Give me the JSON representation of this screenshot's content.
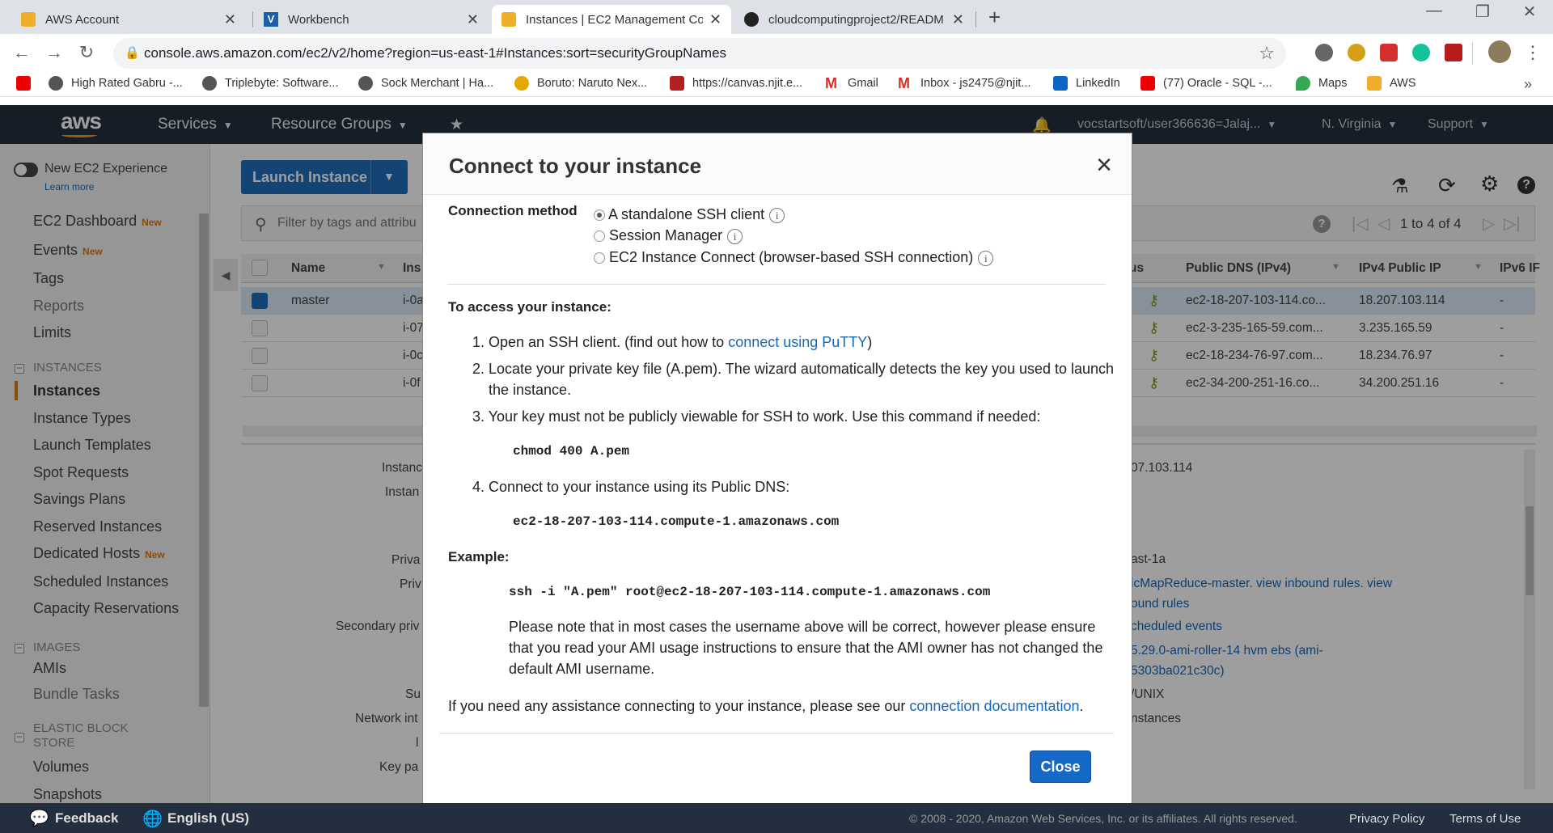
{
  "browser": {
    "tabs": [
      {
        "title": "AWS Account"
      },
      {
        "title": "Workbench"
      },
      {
        "title": "Instances | EC2 Management Co"
      },
      {
        "title": "cloudcomputingproject2/READM"
      }
    ],
    "url": "console.aws.amazon.com/ec2/v2/home?region=us-east-1#Instances:sort=securityGroupNames",
    "bookmarks": [
      "High Rated Gabru -...",
      "Triplebyte: Software...",
      "Sock Merchant | Ha...",
      "Boruto: Naruto Nex...",
      "https://canvas.njit.e...",
      "Gmail",
      "Inbox - js2475@njit...",
      "LinkedIn",
      "(77) Oracle - SQL -...",
      "Maps",
      "AWS"
    ]
  },
  "aws_header": {
    "logo": "aws",
    "services": "Services",
    "resource_groups": "Resource Groups",
    "account": "vocstartsoft/user366636=Jalaj...",
    "region": "N. Virginia",
    "support": "Support"
  },
  "sidebar": {
    "toggle_label": "New EC2 Experience",
    "learn_more": "Learn more",
    "new_badge": "New",
    "items_top": [
      {
        "label": "EC2 Dashboard",
        "new": true
      },
      {
        "label": "Events",
        "new": true
      },
      {
        "label": "Tags"
      },
      {
        "label": "Reports"
      },
      {
        "label": "Limits"
      }
    ],
    "section_instances": "INSTANCES",
    "instances_items": [
      "Instances",
      "Instance Types",
      "Launch Templates",
      "Spot Requests",
      "Savings Plans",
      "Reserved Instances",
      "Dedicated Hosts",
      "Scheduled Instances",
      "Capacity Reservations"
    ],
    "section_images": "IMAGES",
    "images_items": [
      "AMIs",
      "Bundle Tasks"
    ],
    "section_ebs": "ELASTIC BLOCK STORE",
    "ebs_items": [
      "Volumes",
      "Snapshots"
    ]
  },
  "main": {
    "launch_button": "Launch Instance",
    "filter_placeholder": "Filter by tags and attribu",
    "pagination": "1 to 4 of 4",
    "columns": {
      "name": "Name",
      "ins": "Ins",
      "us": "us",
      "dns": "Public DNS (IPv4)",
      "ip": "IPv4 Public IP",
      "ipv6": "IPv6 IF"
    },
    "rows": [
      {
        "name": "master",
        "id": "i-0a",
        "dns": "ec2-18-207-103-114.co...",
        "ip": "18.207.103.114",
        "ipv6": "-"
      },
      {
        "name": "",
        "id": "i-07",
        "dns": "ec2-3-235-165-59.com...",
        "ip": "3.235.165.59",
        "ipv6": "-"
      },
      {
        "name": "",
        "id": "i-0c",
        "dns": "ec2-18-234-76-97.com...",
        "ip": "18.234.76.97",
        "ipv6": "-"
      },
      {
        "name": "",
        "id": "i-0f",
        "dns": "ec2-34-200-251-16.co...",
        "ip": "34.200.251.16",
        "ipv6": "-"
      }
    ],
    "details_left": [
      "Instanc",
      "Instan",
      "Priva",
      "Priv",
      "Secondary priv",
      "Su",
      "Network int",
      "l",
      "Key pa"
    ],
    "details_right": [
      "07.103.114",
      "ast-1a",
      "icMapReduce-master. view inbound rules. view",
      "ound rules",
      "cheduled events",
      "5.29.0-ami-roller-14 hvm ebs (ami-",
      "5303ba021c30c)",
      "/UNIX",
      "nstances"
    ]
  },
  "modal": {
    "title": "Connect to your instance",
    "connection_method_label": "Connection method",
    "options": [
      "A standalone SSH client",
      "Session Manager",
      "EC2 Instance Connect (browser-based SSH connection)"
    ],
    "access_heading": "To access your instance:",
    "step1_prefix": "1. Open an SSH client. (find out how to",
    "step1_link": "connect using PuTTY",
    "step1_suffix": ")",
    "step2_line1": "2. Locate your private key file (A.pem). The wizard automatically detects the key you used to launch",
    "step2_line2": "the instance.",
    "step3": "3. Your key must not be publicly viewable for SSH to work. Use this command if needed:",
    "chmod_cmd": "chmod 400 A.pem",
    "step4": "4. Connect to your instance using its Public DNS:",
    "dns": "ec2-18-207-103-114.compute-1.amazonaws.com",
    "example_label": "Example:",
    "ssh_cmd": "ssh -i \"A.pem\" root@ec2-18-207-103-114.compute-1.amazonaws.com",
    "note_line1": "Please note that in most cases the username above will be correct, however please ensure",
    "note_line2": "that you read your AMI usage instructions to ensure that the AMI owner has not changed the",
    "note_line3": "default AMI username.",
    "assist_prefix": "If you need any assistance connecting to your instance, please see our",
    "assist_link": "connection documentation",
    "assist_suffix": ".",
    "close_button": "Close"
  },
  "footer": {
    "feedback": "Feedback",
    "language": "English (US)",
    "copyright": "© 2008 - 2020, Amazon Web Services, Inc. or its affiliates. All rights reserved.",
    "privacy": "Privacy Policy",
    "terms": "Terms of Use"
  }
}
